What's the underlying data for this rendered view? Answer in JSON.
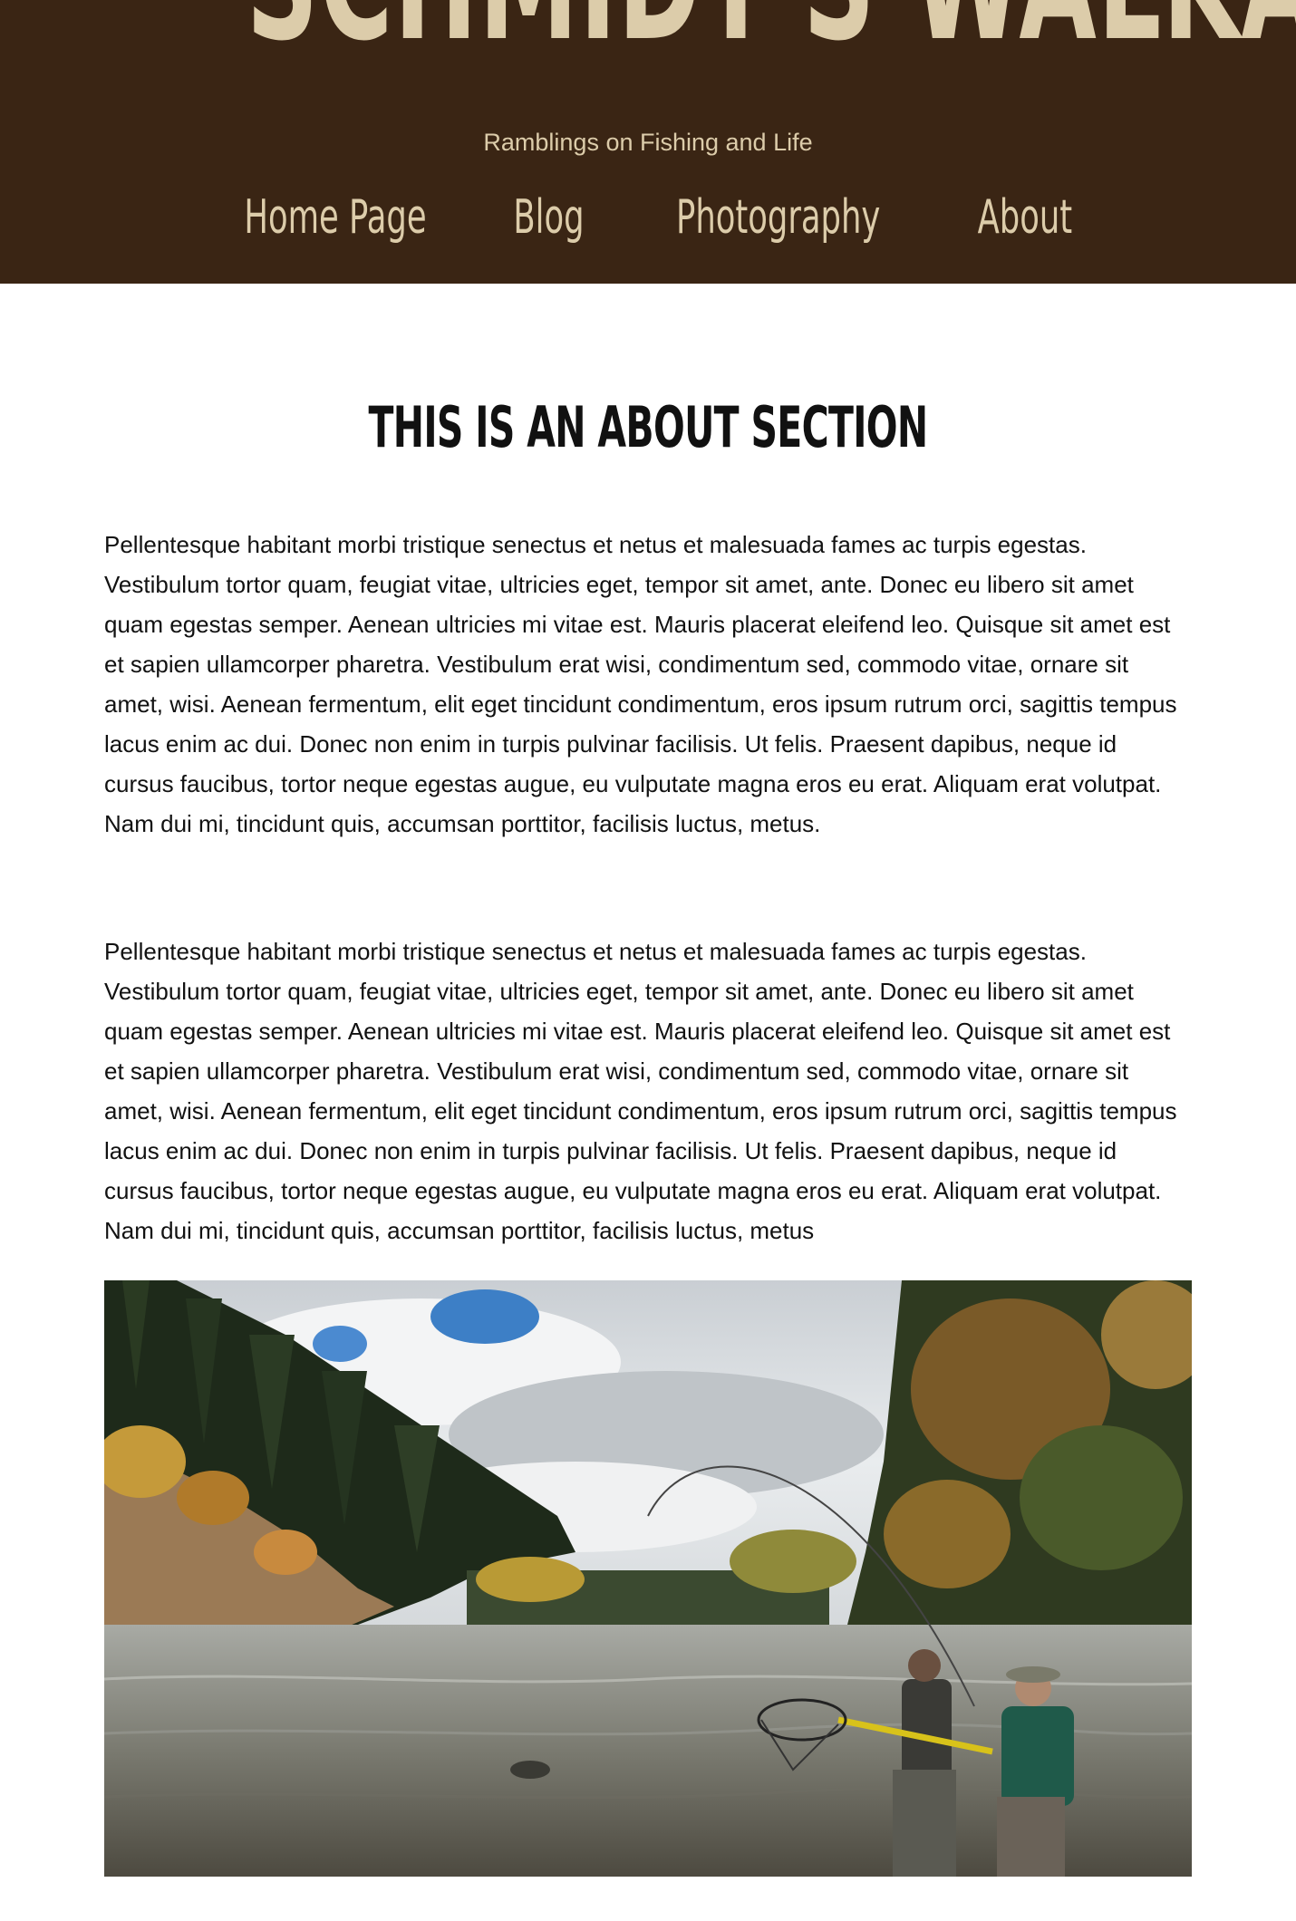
{
  "header": {
    "site_title": "SCHMIDT'S WALKABOUTS",
    "tagline": "Ramblings on Fishing and Life",
    "background_color": "#3a2514",
    "text_color": "#dcccaa"
  },
  "nav": {
    "items": [
      {
        "label": "Home Page"
      },
      {
        "label": "Blog"
      },
      {
        "label": "Photography"
      },
      {
        "label": "About"
      }
    ]
  },
  "main": {
    "title": "THIS IS AN ABOUT SECTION",
    "paragraphs": [
      "Pellentesque habitant morbi tristique senectus et netus et malesuada fames ac turpis egestas. Vestibulum tortor quam, feugiat vitae, ultricies eget, tempor sit amet, ante. Donec eu libero sit amet quam egestas semper. Aenean ultricies mi vitae est. Mauris placerat eleifend leo. Quisque sit amet est et sapien ullamcorper pharetra. Vestibulum erat wisi, condimentum sed, commodo vitae, ornare sit amet, wisi. Aenean fermentum, elit eget tincidunt condimentum, eros ipsum rutrum orci, sagittis tempus lacus enim ac dui. Donec non enim in turpis pulvinar facilisis. Ut felis. Praesent dapibus, neque id cursus faucibus, tortor neque egestas augue, eu vulputate magna eros eu erat. Aliquam erat volutpat. Nam dui mi, tincidunt quis, accumsan porttitor, facilisis luctus, metus.",
      "Pellentesque habitant morbi tristique senectus et netus et malesuada fames ac turpis egestas. Vestibulum tortor quam, feugiat vitae, ultricies eget, tempor sit amet, ante. Donec eu libero sit amet quam egestas semper. Aenean ultricies mi vitae est. Mauris placerat eleifend leo. Quisque sit amet est et sapien ullamcorper pharetra. Vestibulum erat wisi, condimentum sed, commodo vitae, ornare sit amet, wisi. Aenean fermentum, elit eget tincidunt condimentum, eros ipsum rutrum orci, sagittis tempus lacus enim ac dui. Donec non enim in turpis pulvinar facilisis. Ut felis. Praesent dapibus, neque id cursus faucibus, tortor neque egestas augue, eu vulputate magna eros eu erat. Aliquam erat volutpat. Nam dui mi, tincidunt quis, accumsan porttitor, facilisis luctus, metus"
    ]
  }
}
